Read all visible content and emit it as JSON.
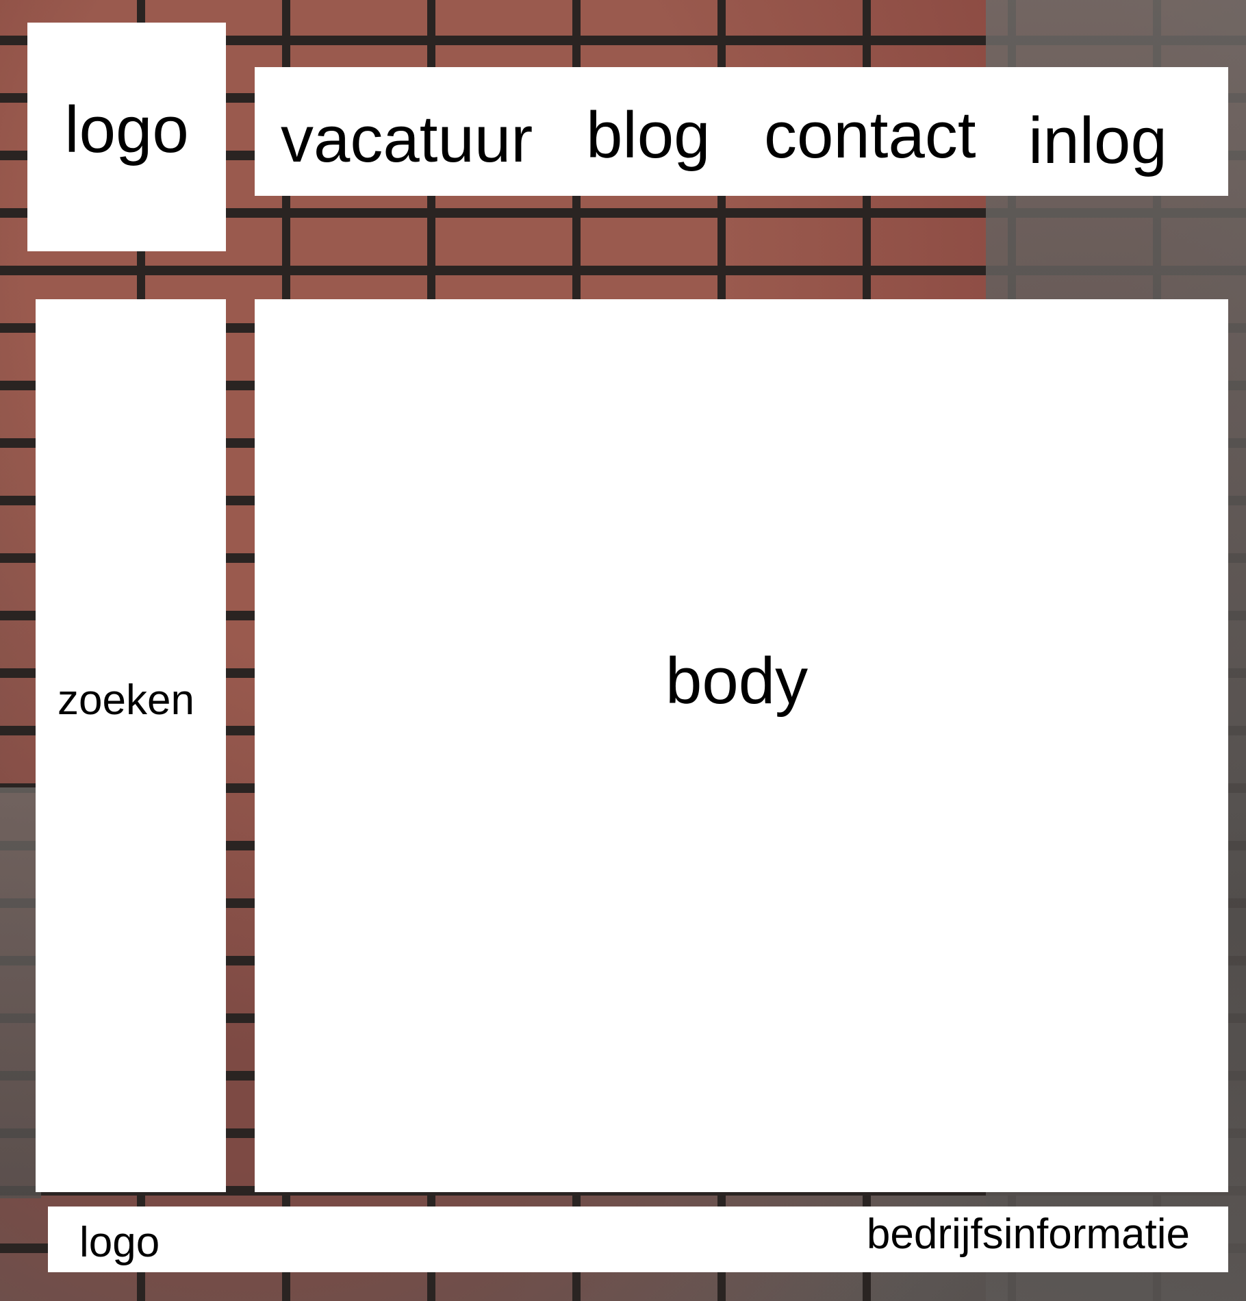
{
  "header": {
    "logo_text": "logo"
  },
  "nav": {
    "items": [
      {
        "label": "vacatuur"
      },
      {
        "label": "blog"
      },
      {
        "label": "contact"
      },
      {
        "label": "inlog"
      }
    ]
  },
  "sidebar": {
    "search_label": "zoeken"
  },
  "main": {
    "body_text": "body"
  },
  "footer": {
    "logo_text": "logo",
    "info_text": "bedrijfsinformatie"
  },
  "colors": {
    "panel_background": "#ffffff",
    "text": "#000000",
    "brick": "#8c4b43",
    "mortar": "#2a2422"
  }
}
